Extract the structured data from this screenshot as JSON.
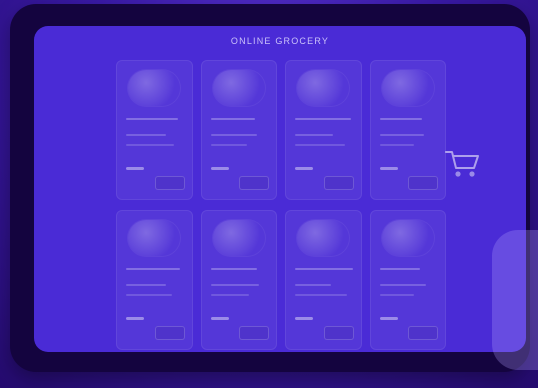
{
  "app": {
    "title": "ONLINE GROCERY"
  },
  "products": [
    {
      "name": "",
      "price": "",
      "add_label": ""
    },
    {
      "name": "",
      "price": "",
      "add_label": ""
    },
    {
      "name": "",
      "price": "",
      "add_label": ""
    },
    {
      "name": "",
      "price": "",
      "add_label": ""
    },
    {
      "name": "",
      "price": "",
      "add_label": ""
    },
    {
      "name": "",
      "price": "",
      "add_label": ""
    },
    {
      "name": "",
      "price": "",
      "add_label": ""
    },
    {
      "name": "",
      "price": "",
      "add_label": ""
    }
  ],
  "icons": {
    "cart": "shopping-cart-icon"
  },
  "colors": {
    "overlay": "#3a1aa8",
    "screen": "#4a2bd6",
    "text": "#d8d2ff"
  }
}
